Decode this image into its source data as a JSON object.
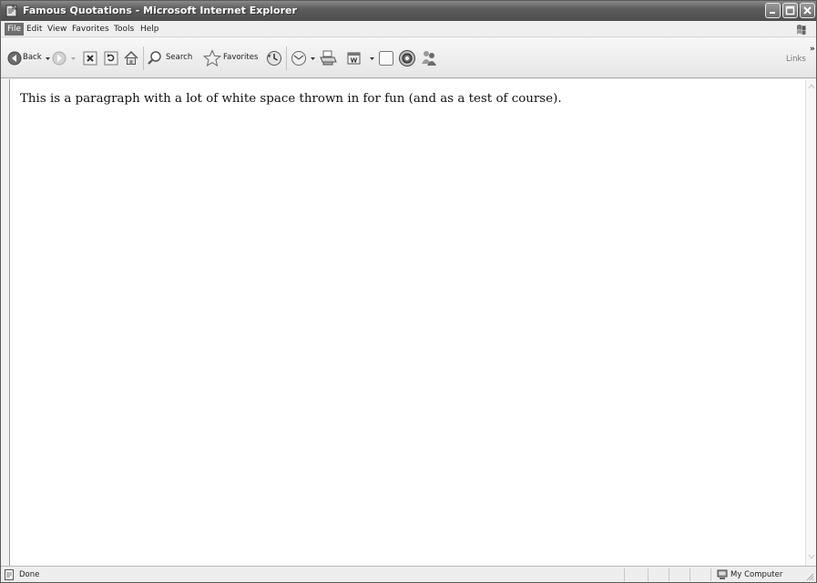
{
  "window": {
    "title": "Famous Quotations - Microsoft Internet Explorer"
  },
  "menu": {
    "items": [
      "File",
      "Edit",
      "View",
      "Favorites",
      "Tools",
      "Help"
    ],
    "active": "File"
  },
  "toolbar": {
    "back_label": "Back",
    "search_label": "Search",
    "favorites_label": "Favorites",
    "links_label": "Links",
    "overflow_glyph": "»",
    "icons": [
      "back-icon",
      "forward-icon",
      "stop-icon",
      "refresh-icon",
      "home-icon",
      "search-icon",
      "favorites-star-icon",
      "history-icon",
      "mail-icon",
      "print-icon",
      "edit-icon",
      "discuss-icon",
      "research-icon",
      "messenger-icon"
    ]
  },
  "content": {
    "paragraph": "This is a paragraph with a lot of white space thrown in for fun (and as a test of course)."
  },
  "status": {
    "text": "Done",
    "zone": "My Computer"
  },
  "colors": {
    "titlebar": "#5c5c5c",
    "menu_active": "#6f6f6f",
    "page_background": "#ffffff"
  }
}
